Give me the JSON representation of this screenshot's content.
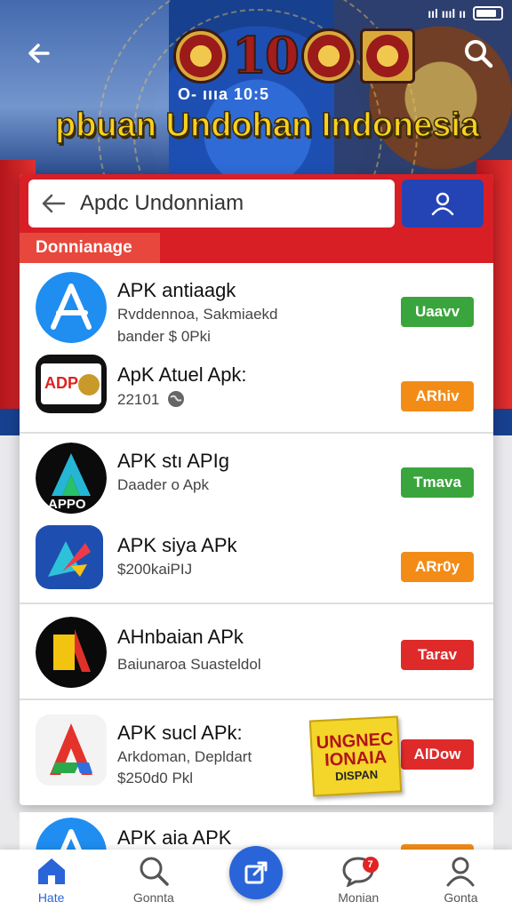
{
  "status_bar": {
    "signal": "ııl ıııl ıı"
  },
  "header": {
    "number": "10",
    "subtitle": "O- ıııa 10:5",
    "title": "pbuan Undohan Indonesia"
  },
  "search": {
    "value": "Apdc Undonniam"
  },
  "section": {
    "label": "Donnianage"
  },
  "apps": [
    {
      "name": "APK antiaagk",
      "line2": "Rvddennoa, Sakmiaekd",
      "line3": "bander $ 0Pki",
      "button": "Uaavv",
      "button_color": "#3aa53d",
      "icon": "blue-a-icon"
    },
    {
      "name": "ApK Atuel Apk:",
      "line2": "22101",
      "line3": "",
      "button": "ARhiv",
      "button_color": "#f28c17",
      "icon": "adp-garuda-icon"
    },
    {
      "name": "APK stı APIg",
      "line2": "Daader o Apk",
      "line3": "",
      "button": "Tmava",
      "button_color": "#3aa53d",
      "icon": "appo-icon"
    },
    {
      "name": "APK siya APk",
      "line2": "$200kaiPIJ",
      "line3": "",
      "button": "ARr0y",
      "button_color": "#f28c17",
      "icon": "colorful-arrow-icon"
    },
    {
      "name": "AHnbaian APk",
      "line2": "Baiunaroa Suasteldol",
      "line3": "",
      "button": "Tarav",
      "button_color": "#df2a2a",
      "icon": "black-yellow-a-icon"
    },
    {
      "name": "APK sucl APk:",
      "line2": "Arkdoman, Depldart",
      "line3": "$250d0 Pkl",
      "button": "AlDow",
      "button_color": "#df2a2a",
      "icon": "red-green-a-icon"
    }
  ],
  "promo": {
    "l1": "UNGNEC",
    "l2": "IONAIA",
    "l3": "DISPAN"
  },
  "peek_app": {
    "name": "APK aia APK"
  },
  "nav": [
    {
      "label": "Hate",
      "icon": "home-icon"
    },
    {
      "label": "Gonnta",
      "icon": "search-icon"
    },
    {
      "label": "",
      "icon": "share-icon"
    },
    {
      "label": "Monian",
      "icon": "chat-icon",
      "badge": "7"
    },
    {
      "label": "Gonta",
      "icon": "user-icon"
    }
  ]
}
